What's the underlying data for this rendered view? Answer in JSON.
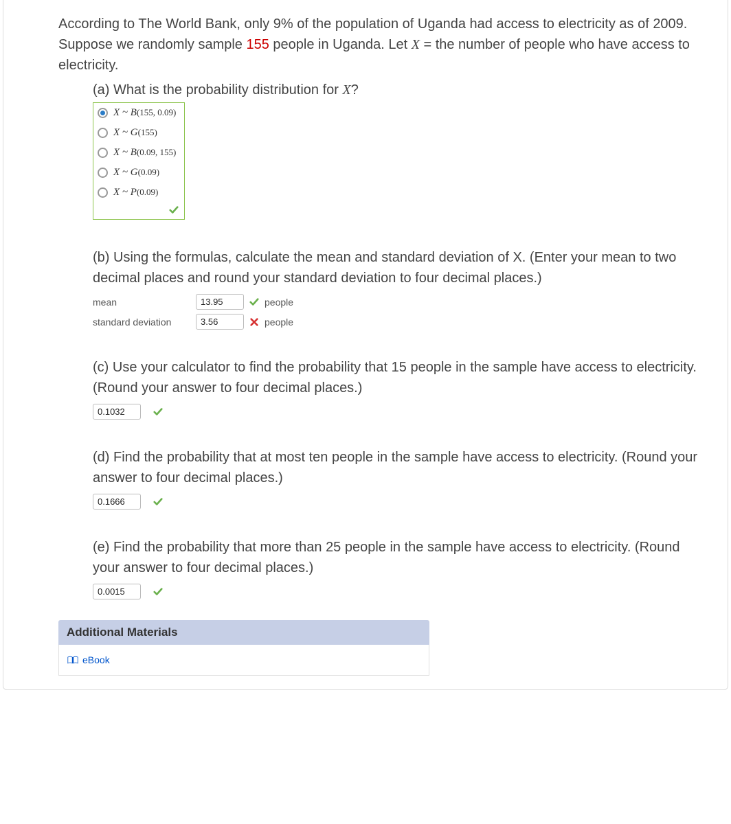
{
  "intro": {
    "line1a": "According to The World Bank, only 9% of the population of Uganda had access to electricity as of 2009. Suppose we randomly sample ",
    "n": "155",
    "line1b": " people in Uganda. Let ",
    "xvar": "X",
    "line1c": " = the number of people who have access to electricity."
  },
  "part_a": {
    "label": "(a) What is the probability distribution for ",
    "xvar": "X",
    "q": "?",
    "options": [
      {
        "text": "X ~ B(155, 0.09)",
        "selected": true
      },
      {
        "text": "X ~ G(155)",
        "selected": false
      },
      {
        "text": "X ~ B(0.09, 155)",
        "selected": false
      },
      {
        "text": "X ~ G(0.09)",
        "selected": false
      },
      {
        "text": "X ~ P(0.09)",
        "selected": false
      }
    ]
  },
  "part_b": {
    "text": "(b) Using the formulas, calculate the mean and standard deviation of X. (Enter your mean to two decimal places and round your standard deviation to four decimal places.)",
    "rows": [
      {
        "label": "mean",
        "value": "13.95",
        "status": "correct",
        "unit": "people"
      },
      {
        "label": "standard deviation",
        "value": "3.56",
        "status": "incorrect",
        "unit": "people"
      }
    ]
  },
  "part_c": {
    "text": "(c) Use your calculator to find the probability that 15 people in the sample have access to electricity. (Round your answer to four decimal places.)",
    "value": "0.1032",
    "status": "correct"
  },
  "part_d": {
    "text": "(d) Find the probability that at most ten people in the sample have access to electricity. (Round your answer to four decimal places.)",
    "value": "0.1666",
    "status": "correct"
  },
  "part_e": {
    "text": "(e) Find the probability that more than 25 people in the sample have access to electricity. (Round your answer to four decimal places.)",
    "value": "0.0015",
    "status": "correct"
  },
  "additional": {
    "header": "Additional Materials",
    "ebook": "eBook"
  }
}
